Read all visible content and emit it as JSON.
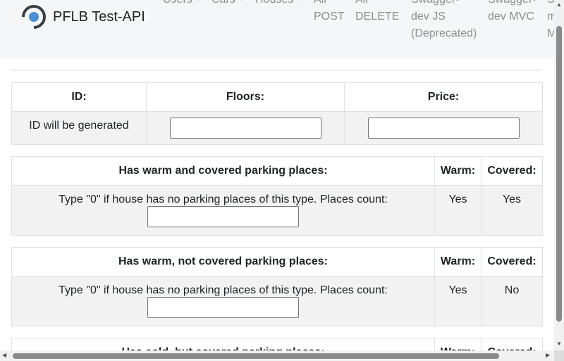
{
  "brand": {
    "name": "PFLB Test-API",
    "logo_icon": "pflb-logo-icon"
  },
  "nav": {
    "users": "Users",
    "cars": "Cars",
    "houses": "Houses",
    "all_post": [
      "All",
      "POST"
    ],
    "all_delete": [
      "All",
      "DELETE"
    ],
    "swagger_js": [
      "Swagger-",
      "dev JS",
      "(Deprecated)"
    ],
    "swagger_mvc": [
      "Swagger-",
      "dev MVC"
    ],
    "cut_off": [
      "S",
      "m",
      "M"
    ]
  },
  "house_table": {
    "headers": {
      "id": "ID:",
      "floors": "Floors:",
      "price": "Price:"
    },
    "id_value": "ID will be generated",
    "floors_value": "",
    "price_value": ""
  },
  "parking": [
    {
      "header": "Has warm and covered parking places:",
      "warm_header": "Warm:",
      "covered_header": "Covered:",
      "hint": "Type \"0\" if house has no parking places of this type. Places count:",
      "count_value": "",
      "warm": "Yes",
      "covered": "Yes"
    },
    {
      "header": "Has warm, not covered parking places:",
      "warm_header": "Warm:",
      "covered_header": "Covered:",
      "hint": "Type \"0\" if house has no parking places of this type. Places count:",
      "count_value": "",
      "warm": "Yes",
      "covered": "No"
    },
    {
      "header": "Has cold, but covered parking places:",
      "warm_header": "Warm:",
      "covered_header": "Covered:"
    }
  ],
  "colors": {
    "navbar_bg": "#f5f6f8",
    "cell_bg": "#f2f2f2",
    "border": "#dee2e6",
    "logo_blue": "#4a90d9"
  }
}
